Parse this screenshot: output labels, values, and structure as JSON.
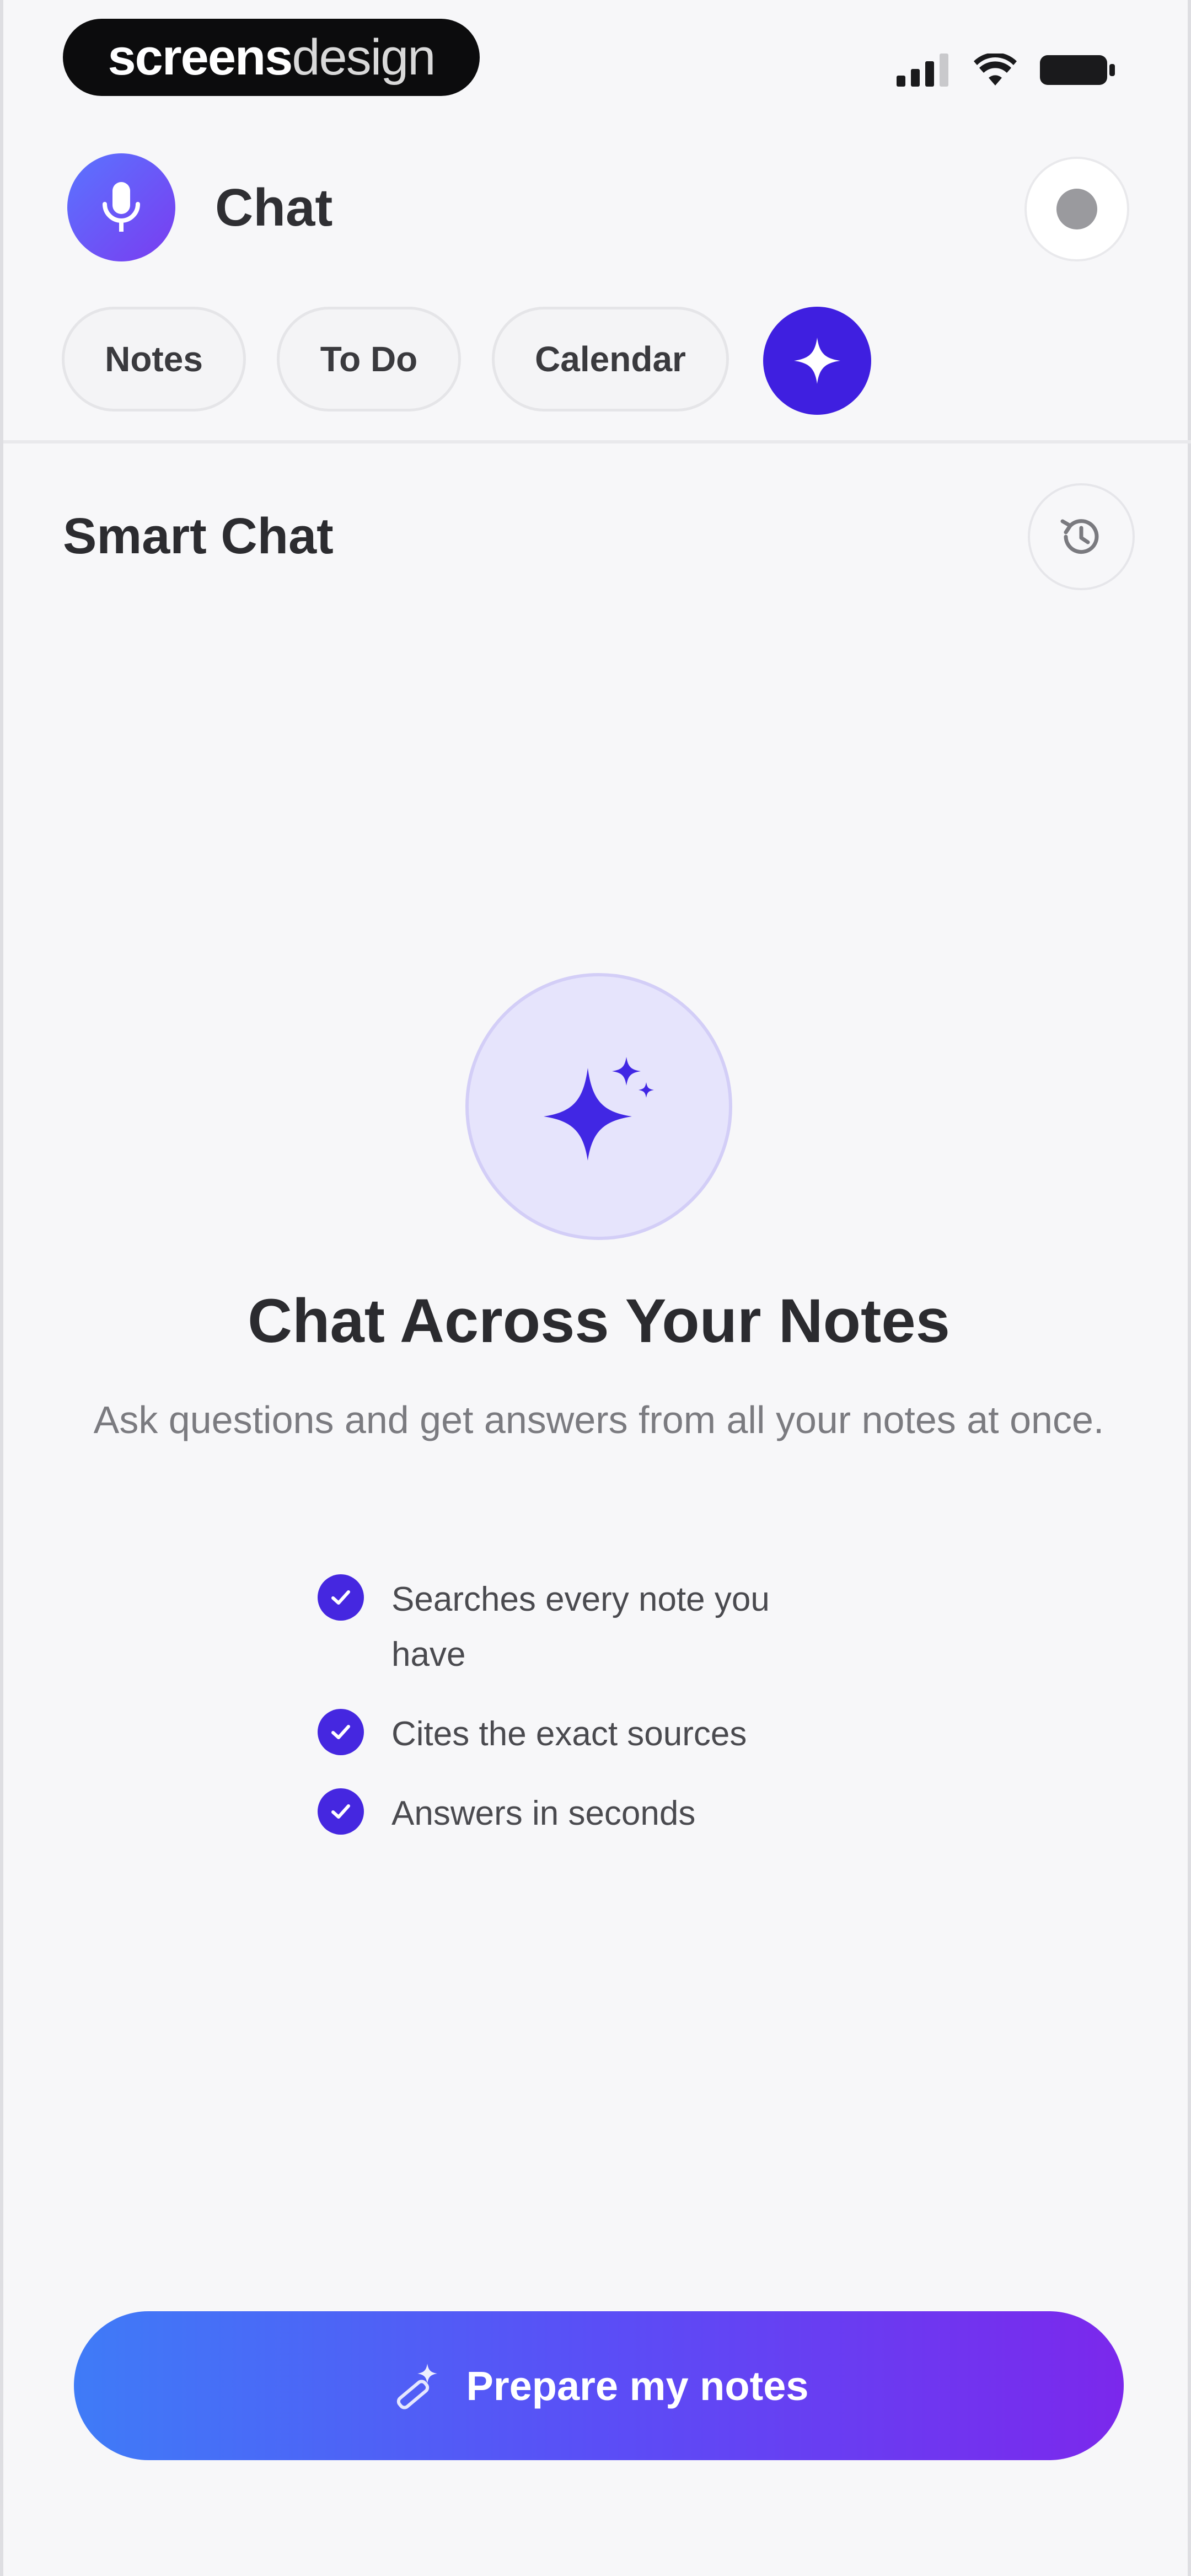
{
  "status_bar": {
    "brand_bold": "screens",
    "brand_light": "design"
  },
  "header": {
    "title": "Chat",
    "avatar_icon": "microphone-icon",
    "settings_icon": "settings-dot-icon"
  },
  "tabs": [
    {
      "label": "Notes"
    },
    {
      "label": "To Do"
    },
    {
      "label": "Calendar"
    },
    {
      "icon": "sparkle-icon",
      "active": true
    }
  ],
  "section": {
    "title": "Smart Chat",
    "history_icon": "history-icon"
  },
  "hero": {
    "icon": "sparkle-icon",
    "title": "Chat Across Your Notes",
    "subtitle": "Ask questions and get answers from all your notes at once."
  },
  "features": [
    {
      "text": "Searches every note you have"
    },
    {
      "text": "Cites the exact sources"
    },
    {
      "text": "Answers in seconds"
    }
  ],
  "cta": {
    "label": "Prepare my notes",
    "icon": "magic-wand-icon"
  },
  "colors": {
    "accent": "#3f1fe0",
    "check": "#4527e0",
    "gradient_start": "#3f7bf7",
    "gradient_end": "#7b28ec",
    "hero_bg": "#e6e4fc"
  }
}
